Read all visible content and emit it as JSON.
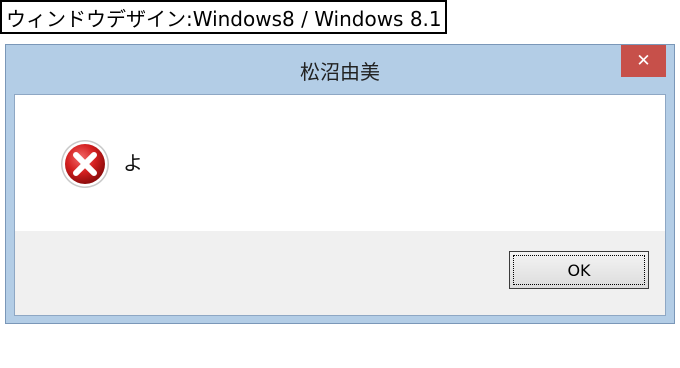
{
  "caption": "ウィンドウデザイン:Windows8 / Windows 8.1",
  "dialog": {
    "title": "松沼由美",
    "close_glyph": "✕",
    "message": "よ",
    "icon": "error-icon",
    "ok_label": "OK"
  },
  "colors": {
    "frame": "#b3cde6",
    "close_button": "#c7504a",
    "button_area": "#f0f0f0",
    "error_red": "#d42020"
  }
}
